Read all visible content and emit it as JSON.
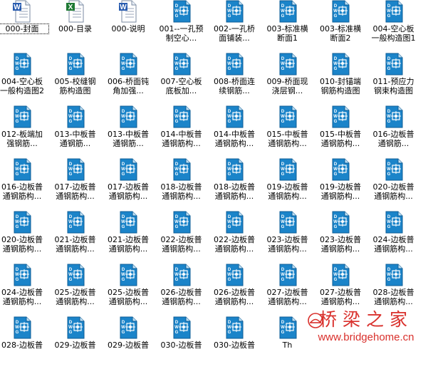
{
  "icons": {
    "word": "word-document-icon",
    "excel": "excel-spreadsheet-icon",
    "dwg": "dwg-drawing-file-icon"
  },
  "colors": {
    "dwg_blue": "#1b84c9",
    "dwg_dark": "#0e5d96",
    "word_blue": "#2a5db0",
    "excel_green": "#1f7a35",
    "watermark_red": "#d9302c"
  },
  "files": [
    {
      "name": "000-封面",
      "type": "word",
      "selected": true
    },
    {
      "name": "000-目录",
      "type": "excel"
    },
    {
      "name": "000-说明",
      "type": "word"
    },
    {
      "name": "001--一孔预\n制空心...",
      "type": "dwg"
    },
    {
      "name": "002-一孔桥\n面铺装...",
      "type": "dwg"
    },
    {
      "name": "003-标准横\n断面1",
      "type": "dwg"
    },
    {
      "name": "003-标准横\n断面2",
      "type": "dwg"
    },
    {
      "name": "004-空心板\n一般构造图1",
      "type": "dwg"
    },
    {
      "name": "004-空心板\n一般构造图2",
      "type": "dwg"
    },
    {
      "name": "005-校缝钢\n筋构造图",
      "type": "dwg"
    },
    {
      "name": "006-桥面钝\n角加强...",
      "type": "dwg"
    },
    {
      "name": "007-空心板\n底板加...",
      "type": "dwg"
    },
    {
      "name": "008-桥面连\n续钢筋...",
      "type": "dwg"
    },
    {
      "name": "009-桥面现\n浇层钢...",
      "type": "dwg"
    },
    {
      "name": "010-封锚端\n钢筋构造图",
      "type": "dwg"
    },
    {
      "name": "011-预应力\n钢束构造图",
      "type": "dwg"
    },
    {
      "name": "012-板端加\n强钢筋...",
      "type": "dwg"
    },
    {
      "name": "013-中板普\n通钢筋...",
      "type": "dwg"
    },
    {
      "name": "013-中板普\n通钢筋...",
      "type": "dwg"
    },
    {
      "name": "014-中板普\n通钢筋构...",
      "type": "dwg"
    },
    {
      "name": "014-中板普\n通钢筋构...",
      "type": "dwg"
    },
    {
      "name": "015-中板普\n通钢筋构...",
      "type": "dwg"
    },
    {
      "name": "015-中板普\n通钢筋构...",
      "type": "dwg"
    },
    {
      "name": "016-边板普\n通钢筋...",
      "type": "dwg"
    },
    {
      "name": "016-边板普\n通钢筋构...",
      "type": "dwg"
    },
    {
      "name": "017-边板普\n通钢筋构...",
      "type": "dwg"
    },
    {
      "name": "017-边板普\n通钢筋构...",
      "type": "dwg"
    },
    {
      "name": "018-边板普\n通钢筋构...",
      "type": "dwg"
    },
    {
      "name": "018-边板普\n通钢筋构...",
      "type": "dwg"
    },
    {
      "name": "019-边板普\n通钢筋构...",
      "type": "dwg"
    },
    {
      "name": "019-边板普\n通钢筋构...",
      "type": "dwg"
    },
    {
      "name": "020-边板普\n通钢筋构...",
      "type": "dwg"
    },
    {
      "name": "020-边板普\n通钢筋构...",
      "type": "dwg"
    },
    {
      "name": "021-边板普\n通钢筋构...",
      "type": "dwg"
    },
    {
      "name": "021-边板普\n通钢筋构...",
      "type": "dwg"
    },
    {
      "name": "022-边板普\n通钢筋构...",
      "type": "dwg"
    },
    {
      "name": "022-边板普\n通钢筋构...",
      "type": "dwg"
    },
    {
      "name": "023-边板普\n通钢筋构...",
      "type": "dwg"
    },
    {
      "name": "023-边板普\n通钢筋构...",
      "type": "dwg"
    },
    {
      "name": "024-边板普\n通钢筋构...",
      "type": "dwg"
    },
    {
      "name": "024-边板普\n通钢筋构...",
      "type": "dwg"
    },
    {
      "name": "025-边板普\n通钢筋构...",
      "type": "dwg"
    },
    {
      "name": "025-边板普\n通钢筋构...",
      "type": "dwg"
    },
    {
      "name": "026-边板普\n通钢筋构...",
      "type": "dwg"
    },
    {
      "name": "026-边板普\n通钢筋构...",
      "type": "dwg"
    },
    {
      "name": "027-边板普\n通钢筋构...",
      "type": "dwg"
    },
    {
      "name": "027-边板普\n通钢筋构...",
      "type": "dwg"
    },
    {
      "name": "028-边板普\n通钢筋构...",
      "type": "dwg"
    },
    {
      "name": "028-边板普",
      "type": "dwg"
    },
    {
      "name": "029-边板普",
      "type": "dwg"
    },
    {
      "name": "029-边板普",
      "type": "dwg"
    },
    {
      "name": "030-边板普",
      "type": "dwg"
    },
    {
      "name": "030-边板普",
      "type": "dwg"
    },
    {
      "name": "Th",
      "type": "dwg"
    }
  ],
  "watermark": {
    "title": "桥梁之家",
    "url": "www.bridgehome.cn"
  }
}
